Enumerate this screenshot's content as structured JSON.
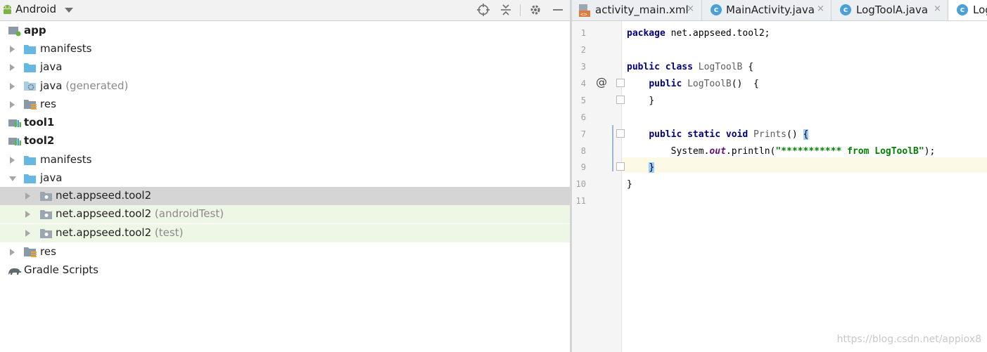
{
  "project_panel": {
    "title": "Android",
    "tree": [
      {
        "label": "app",
        "suffix": "",
        "bold": true,
        "icon": "module-icon"
      },
      {
        "label": "manifests",
        "suffix": "",
        "bold": false,
        "icon": "folder-icon"
      },
      {
        "label": "java",
        "suffix": "",
        "bold": false,
        "icon": "folder-icon"
      },
      {
        "label": "java",
        "suffix": " (generated)",
        "bold": false,
        "icon": "generated-folder-icon"
      },
      {
        "label": "res",
        "suffix": "",
        "bold": false,
        "icon": "res-folder-icon"
      },
      {
        "label": "tool1",
        "suffix": "",
        "bold": true,
        "icon": "library-module-icon"
      },
      {
        "label": "tool2",
        "suffix": "",
        "bold": true,
        "icon": "library-module-icon"
      },
      {
        "label": "manifests",
        "suffix": "",
        "bold": false,
        "icon": "folder-icon"
      },
      {
        "label": "java",
        "suffix": "",
        "bold": false,
        "icon": "folder-icon"
      },
      {
        "label": "net.appseed.tool2",
        "suffix": "",
        "bold": false,
        "icon": "package-icon"
      },
      {
        "label": "net.appseed.tool2",
        "suffix": " (androidTest)",
        "bold": false,
        "icon": "package-icon"
      },
      {
        "label": "net.appseed.tool2",
        "suffix": " (test)",
        "bold": false,
        "icon": "package-icon"
      },
      {
        "label": "res",
        "suffix": "",
        "bold": false,
        "icon": "res-folder-icon"
      },
      {
        "label": "Gradle Scripts",
        "suffix": "",
        "bold": false,
        "icon": "gradle-icon"
      }
    ]
  },
  "editor": {
    "tabs": [
      {
        "label": "activity_main.xml",
        "close": "×"
      },
      {
        "label": "MainActivity.java",
        "close": "×"
      },
      {
        "label": "LogToolA.java",
        "close": "×"
      },
      {
        "label": "Log",
        "close": ""
      }
    ],
    "line_numbers": [
      "1",
      "2",
      "3",
      "4",
      "5",
      "6",
      "7",
      "8",
      "9",
      "10",
      "11"
    ],
    "code": {
      "l1_kw": "package",
      "l1_rest": " net.appseed.tool2;",
      "l3_kw1": "public",
      "l3_kw2": "class",
      "l3_cls": "LogToolB",
      "l3_rest": " {",
      "l4_kw": "public",
      "l4_cls": "LogToolB",
      "l4_rest": "()  {",
      "l5": "}",
      "l7_kw1": "public",
      "l7_kw2": "static",
      "l7_kw3": "void",
      "l7_name": "Prints",
      "l7_rest": "()",
      "l7_brace": "{",
      "l8_a": "System.",
      "l8_field": "out",
      "l8_b": ".println(",
      "l8_str": "\"*********** from LogToolB\"",
      "l8_c": ");",
      "l9_brace": "}",
      "l10": "}"
    },
    "gutter_marker": "@"
  },
  "watermark": "https://blog.csdn.net/appiox8",
  "colors": {
    "accent": "#4aa1d9",
    "selection": "#d5d5d5",
    "test_bg": "#eef7e6",
    "current_line": "#fcfae6"
  }
}
